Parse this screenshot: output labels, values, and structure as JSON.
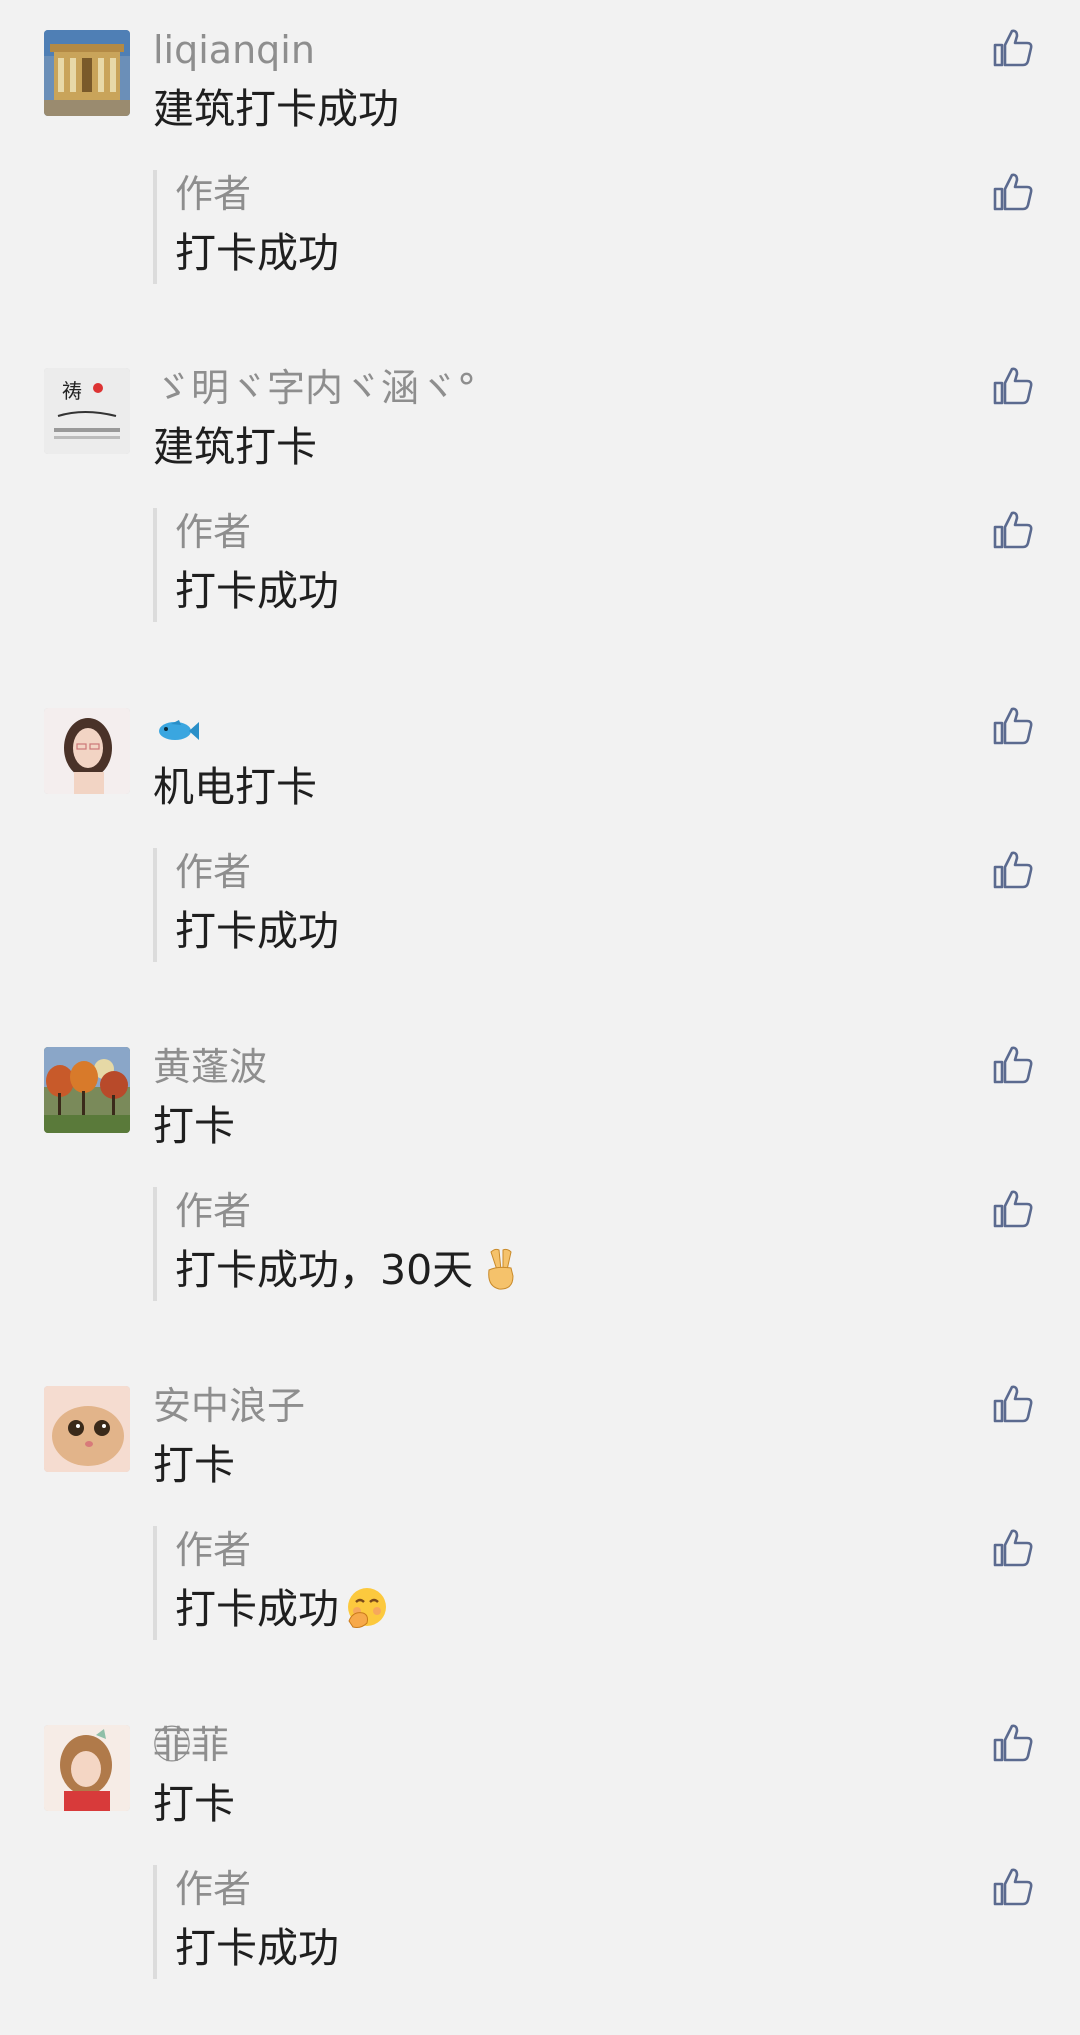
{
  "icons": {
    "like": "thumbs-up-icon",
    "reply_emojis": [
      "victory-hand-emoji",
      "hand-over-mouth-emoji"
    ],
    "fish": "fish-emoji"
  },
  "colors": {
    "background": "#f2f2f2",
    "username": "#8e8e8e",
    "text": "#1f1f1f",
    "like_icon": "#5b6a8f"
  },
  "comments": [
    {
      "username": "liqianqin",
      "content": "建筑打卡成功",
      "reply": {
        "author": "作者",
        "text": "打卡成功"
      }
    },
    {
      "username": "ゞ明ヾ字内ヾ涵ヾ°",
      "content": "建筑打卡",
      "reply": {
        "author": "作者",
        "text": "打卡成功"
      }
    },
    {
      "username": "",
      "content": "机电打卡",
      "reply": {
        "author": "作者",
        "text": "打卡成功"
      }
    },
    {
      "username": "黄蓬波",
      "content": "打卡",
      "reply": {
        "author": "作者",
        "text": "打卡成功，30天"
      }
    },
    {
      "username": "安中浪子",
      "content": "打卡",
      "reply": {
        "author": "作者",
        "text": "打卡成功"
      }
    },
    {
      "username": "菲⃝菲",
      "content": "打卡",
      "reply": {
        "author": "作者",
        "text": "打卡成功"
      }
    }
  ]
}
